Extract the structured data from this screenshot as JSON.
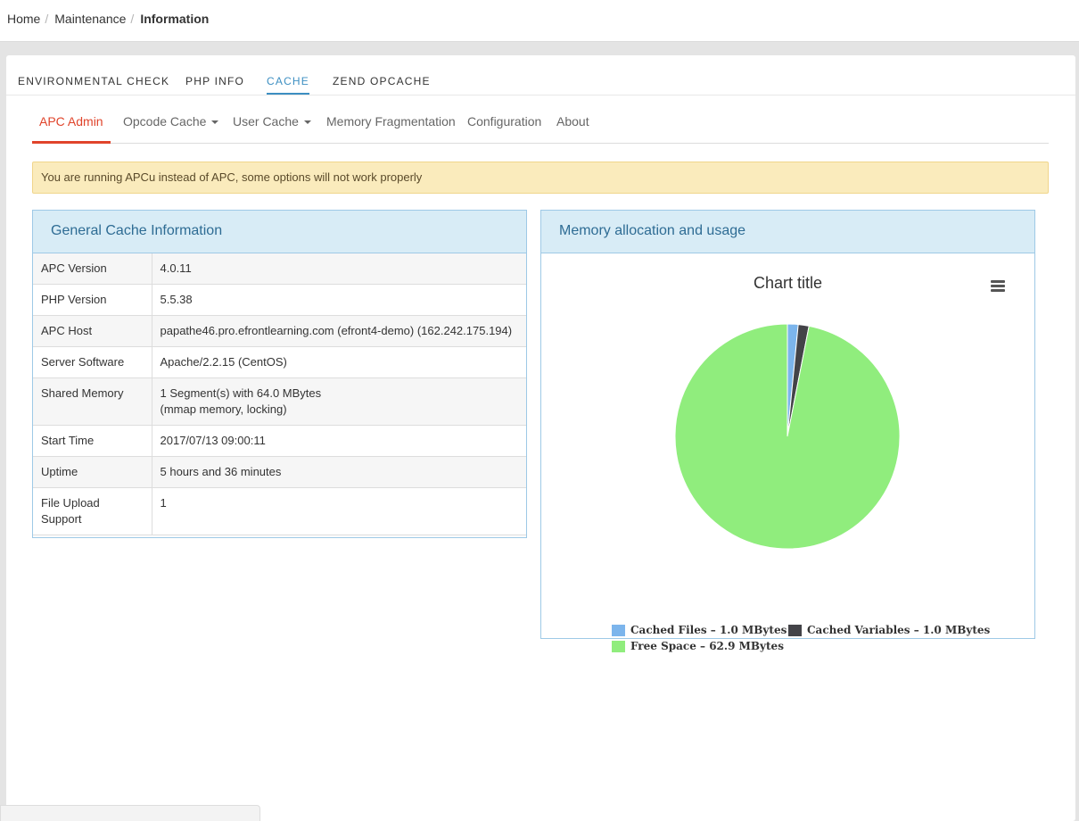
{
  "breadcrumb": {
    "items": [
      "Home",
      "Maintenance"
    ],
    "current": "Information",
    "separator": "/"
  },
  "top_tabs": [
    {
      "label": "ENVIRONMENTAL CHECK"
    },
    {
      "label": "PHP INFO"
    },
    {
      "label": "CACHE"
    },
    {
      "label": "ZEND OPCACHE"
    }
  ],
  "sub_tabs": [
    {
      "label": "APC Admin"
    },
    {
      "label": "Opcode Cache"
    },
    {
      "label": "User Cache"
    },
    {
      "label": "Memory Fragmentation"
    },
    {
      "label": "Configuration"
    },
    {
      "label": "About"
    }
  ],
  "alert": {
    "text": "You are running APCu instead of APC, some options will not work properly"
  },
  "general_panel": {
    "title": "General Cache Information",
    "rows": [
      {
        "key": "APC Version",
        "value": "4.0.11"
      },
      {
        "key": "PHP Version",
        "value": "5.5.38"
      },
      {
        "key": "APC Host",
        "value": "papathe46.pro.efrontlearning.com (efront4-demo) (162.242.175.194)"
      },
      {
        "key": "Server Software",
        "value": "Apache/2.2.15 (CentOS)"
      },
      {
        "key": "Shared Memory",
        "value": "1 Segment(s) with 64.0 MBytes",
        "value2": "(mmap memory, locking)"
      },
      {
        "key": "Start Time",
        "value": "2017/07/13 09:00:11"
      },
      {
        "key": "Uptime",
        "value": "5 hours and 36 minutes"
      },
      {
        "key": "File Upload Support",
        "value": "1"
      }
    ]
  },
  "memory_panel": {
    "title": "Memory allocation and usage"
  },
  "chart_data": {
    "type": "pie",
    "title": "Chart title",
    "slices": [
      {
        "label": "Cached Files – 1.0 MBytes",
        "value": 1.0,
        "color": "#7cb5ec"
      },
      {
        "label": "Cached Variables – 1.0 MBytes",
        "value": 1.0,
        "color": "#434348"
      },
      {
        "label": "Free Space – 62.9 MBytes",
        "value": 62.9,
        "color": "#90ed7d"
      }
    ],
    "legend_position": "bottom"
  },
  "colors": {
    "accent": "#3d8fc2",
    "active_subtab": "#e0442b",
    "alert_bg": "#faebbc",
    "panel_heading_bg": "#d8ecf6"
  },
  "icons": {
    "chart_menu": "hamburger-menu-icon",
    "dropdown": "caret-down-icon"
  }
}
